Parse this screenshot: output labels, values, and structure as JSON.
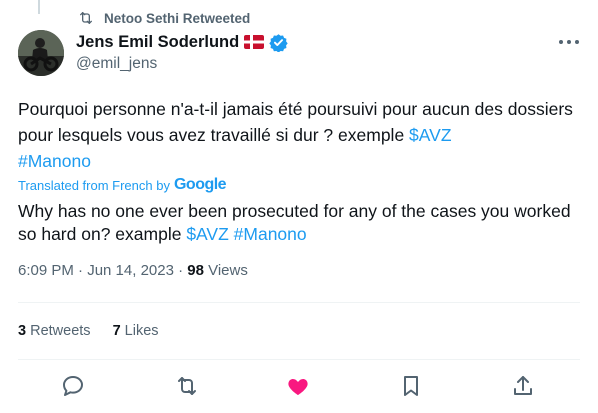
{
  "retweet": {
    "text": "Netoo Sethi Retweeted"
  },
  "author": {
    "name": "Jens Emil Soderlund",
    "handle": "@emil_jens"
  },
  "tweet": {
    "text_part1": "Pourquoi personne n'a-t-il jamais été poursuivi pour aucun des dossiers pour lesquels vous avez travaillé si dur ? exemple ",
    "tag1": "$AVZ",
    "tag2": "#Manono",
    "translated_label": "Translated from French by",
    "google": "Google",
    "translation_part1": "Why has no one ever been prosecuted for any of the cases you worked so hard on? example ",
    "ttag1": "$AVZ",
    "ttag2": "#Manono"
  },
  "meta": {
    "time": "6:09 PM · Jun 14, 2023 · ",
    "views_count": "98",
    "views_label": " Views"
  },
  "stats": {
    "retweets_count": "3",
    "retweets_label": " Retweets",
    "likes_count": "7",
    "likes_label": " Likes"
  },
  "colors": {
    "link": "#1d9bf0",
    "like_active": "#f91880",
    "verified": "#1d9bf0",
    "muted": "#536471"
  },
  "icons": {
    "retweet": "retweet-icon",
    "reply": "reply-icon",
    "like": "heart-icon",
    "bookmark": "bookmark-icon",
    "share": "share-icon",
    "more": "more-icon"
  }
}
